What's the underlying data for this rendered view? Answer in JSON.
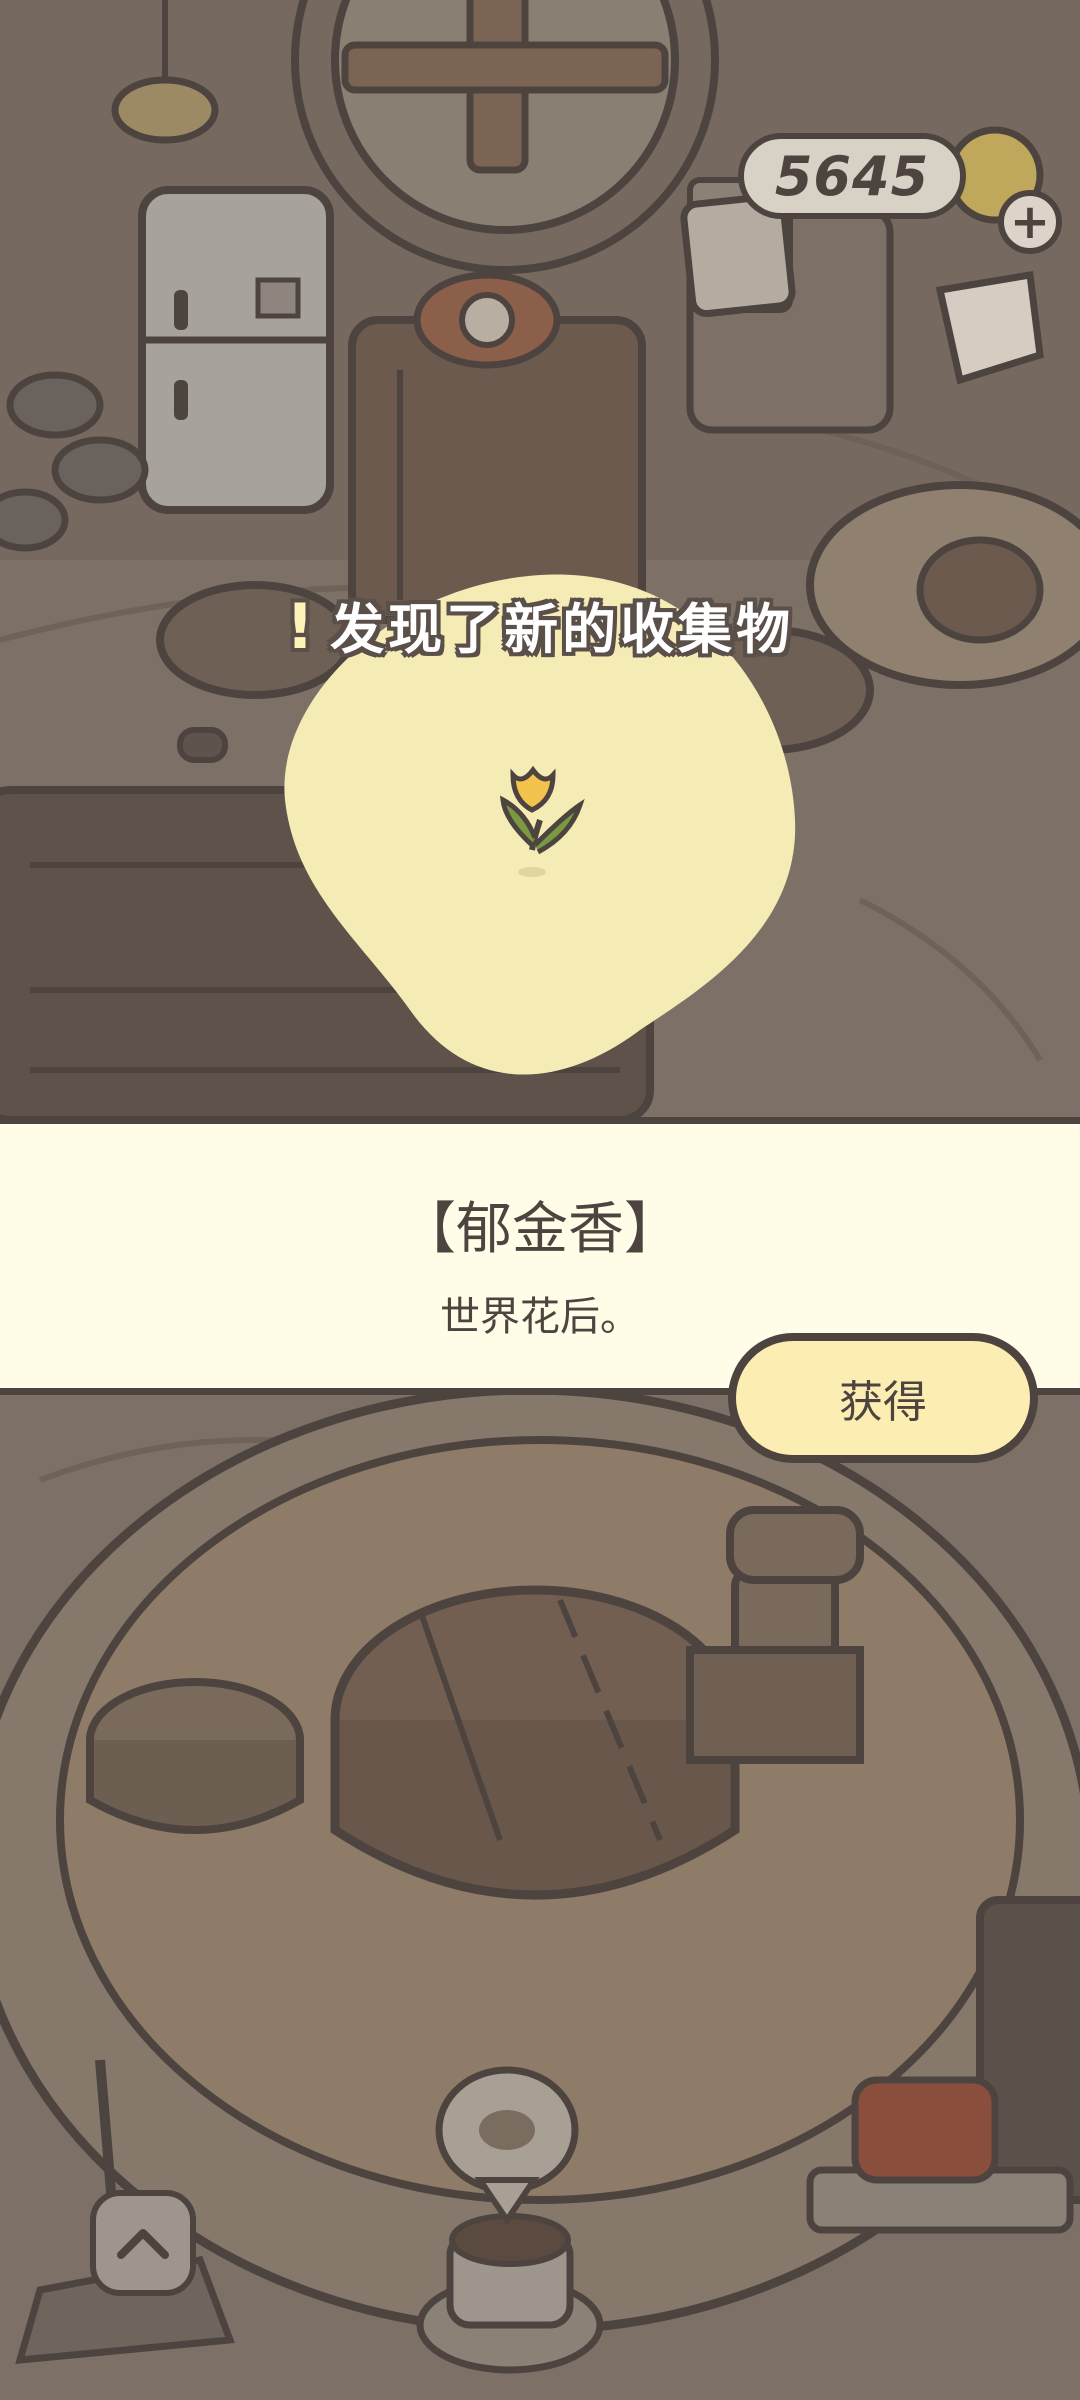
{
  "hud": {
    "coin_count": "5645",
    "add_coins_icon": "plus-icon",
    "mail_icon": "envelope-icon",
    "tickets_icon": "cup-icon"
  },
  "discovery": {
    "title": "发现了新的收集物",
    "exclaim_icon": "exclamation-icon",
    "item_icon": "tulip-icon"
  },
  "item": {
    "name": "【郁金香】",
    "description": "世界花后。"
  },
  "actions": {
    "get_label": "获得"
  },
  "nav": {
    "scroll_up_icon": "chevron-up-icon"
  },
  "colors": {
    "outline": "#4d4440",
    "panel": "#fffce8",
    "button": "#fcedb3",
    "highlight_blob": "#f5ebb5",
    "tulip_petal": "#f3c34d",
    "tulip_leaf": "#7a9a42"
  }
}
